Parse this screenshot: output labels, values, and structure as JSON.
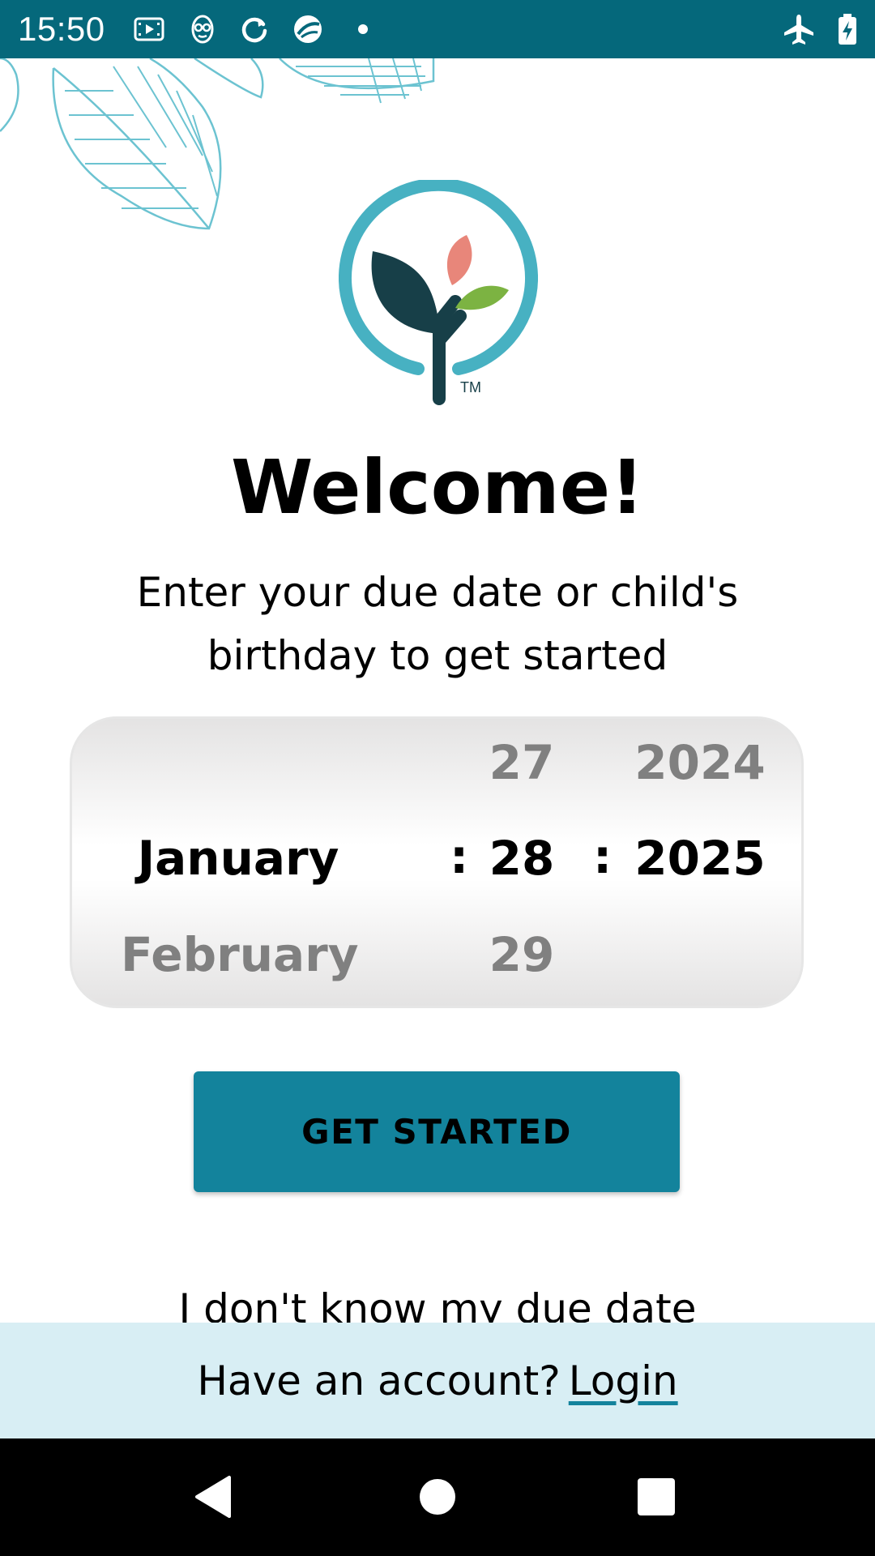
{
  "status_bar": {
    "time": "15:50",
    "left_icons": [
      "screen-record-icon",
      "app-mascot-icon",
      "sync-icon",
      "browser-icon",
      "notification-dot-icon"
    ],
    "right_icons": [
      "airplane-mode-icon",
      "battery-charging-icon"
    ],
    "background": "#05687b"
  },
  "welcome": {
    "title": "Welcome!",
    "subtitle": "Enter your due date or child's birthday to get started"
  },
  "date_picker": {
    "month": {
      "above": "",
      "selected": "January",
      "below": "February"
    },
    "day": {
      "above": "27",
      "selected": "28",
      "below": "29"
    },
    "year": {
      "above": "2024",
      "selected": "2025",
      "below": ""
    },
    "separator": ":"
  },
  "actions": {
    "get_started_label": "GET STARTED",
    "unknown_due_date_label": "I don't know my due date"
  },
  "account": {
    "prompt": "Have an account?",
    "login_label": "Login"
  },
  "logo": {
    "tm_mark": "TM"
  },
  "colors": {
    "accent": "#13839c",
    "status_bar": "#05687b",
    "footer_bg": "#d8eef4",
    "logo_ring": "#47b1c2",
    "logo_stem": "#173f48",
    "logo_petal_pink": "#e8867a",
    "logo_leaf_green": "#7cb342"
  },
  "nav_bar": {
    "buttons": [
      "back-icon",
      "home-icon",
      "recents-icon"
    ]
  }
}
